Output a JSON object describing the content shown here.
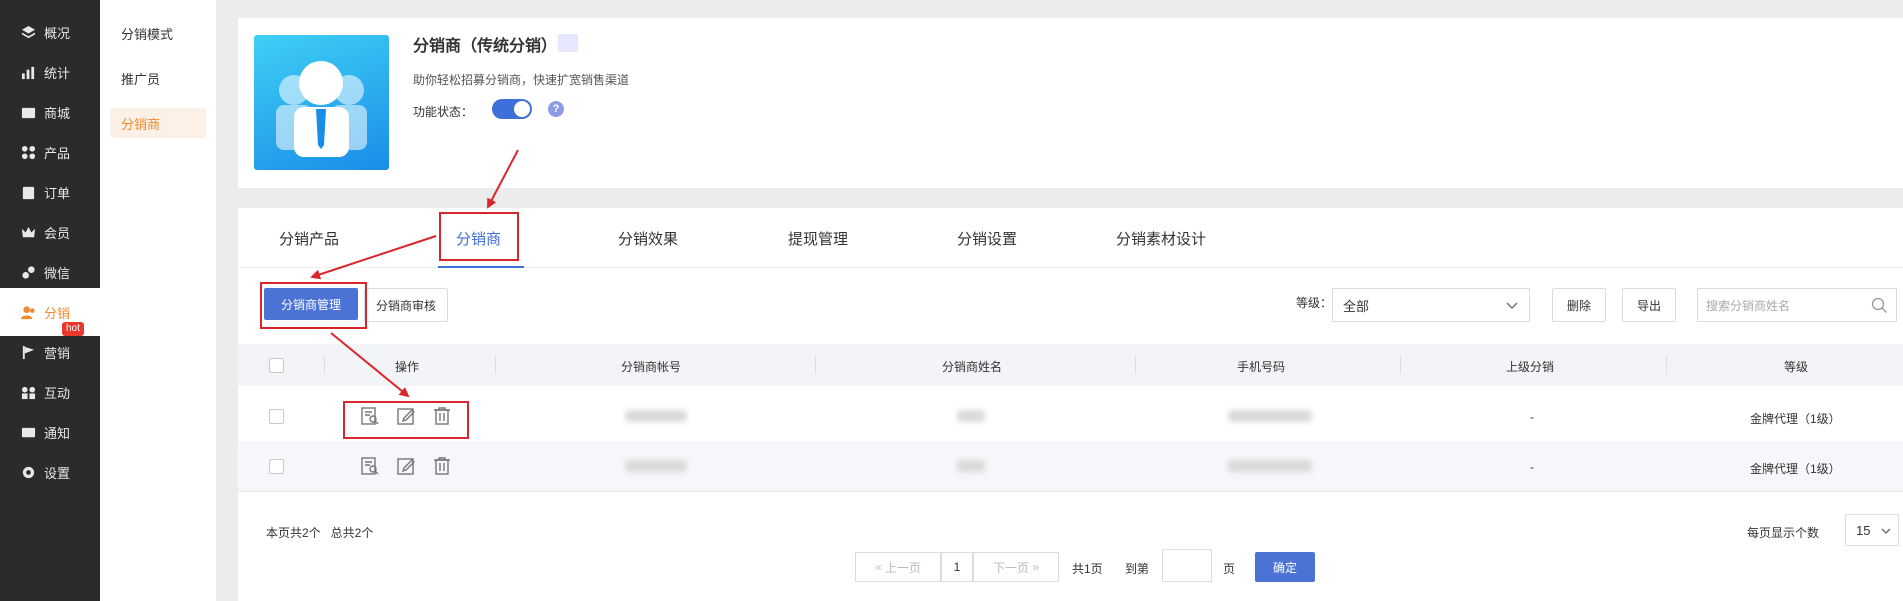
{
  "nav": {
    "items": [
      {
        "label": "概况",
        "icon": "layers-icon"
      },
      {
        "label": "统计",
        "icon": "chart-icon"
      },
      {
        "label": "商城",
        "icon": "mail-icon"
      },
      {
        "label": "产品",
        "icon": "grid-icon"
      },
      {
        "label": "订单",
        "icon": "clipboard-icon"
      },
      {
        "label": "会员",
        "icon": "crown-icon"
      },
      {
        "label": "微信",
        "icon": "link-icon"
      },
      {
        "label": "分销",
        "icon": "user-icon"
      },
      {
        "label": "营销",
        "icon": "flag-icon"
      },
      {
        "label": "互动",
        "icon": "interact-icon"
      },
      {
        "label": "通知",
        "icon": "envelope-icon"
      },
      {
        "label": "设置",
        "icon": "gear-icon"
      }
    ],
    "hot_badge": "hot"
  },
  "subnav": {
    "items": [
      "分销模式",
      "推广员",
      "分销商"
    ]
  },
  "header": {
    "title": "分销商（传统分销）",
    "description": "助你轻松招募分销商，快速扩宽销售渠道",
    "status_label": "功能状态：",
    "help": "?"
  },
  "tabs": [
    "分销产品",
    "分销商",
    "分销效果",
    "提现管理",
    "分销设置",
    "分销素材设计"
  ],
  "toolbar": {
    "manage_btn": "分销商管理",
    "review_btn": "分销商审核",
    "level_label": "等级：",
    "level_value": "全部",
    "delete_btn": "删除",
    "export_btn": "导出",
    "search_placeholder": "搜索分销商姓名"
  },
  "table": {
    "headers": [
      "操作",
      "分销商帐号",
      "分销商姓名",
      "手机号码",
      "上级分销",
      "等级"
    ],
    "rows": [
      {
        "parent": "-",
        "level": "金牌代理（1级）"
      },
      {
        "parent": "-",
        "level": "金牌代理（1级）"
      }
    ]
  },
  "footer": {
    "summary": "本页共2个   总共2个",
    "prev": "上一页",
    "page": "1",
    "next": "下一页",
    "total_pages": "共1页",
    "goto_label": "到第",
    "page_unit": "页",
    "confirm": "确定",
    "per_page_label": "每页显示个数",
    "per_page_value": "15"
  },
  "colors": {
    "sidebar": "#2b2b2b",
    "accent_orange": "#ef8a2e",
    "primary_blue": "#4b73d6",
    "annotation_red": "#d9262c"
  }
}
